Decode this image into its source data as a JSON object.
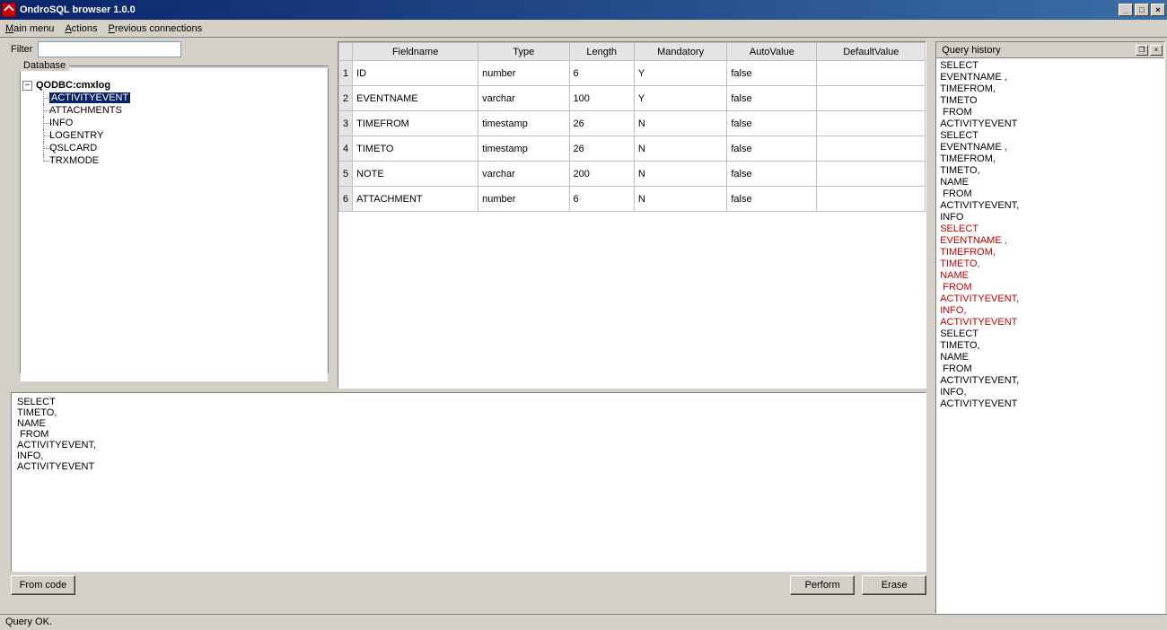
{
  "title": "OndroSQL browser 1.0.0",
  "menu": {
    "main": "Main menu",
    "actions": "Actions",
    "prev": "Previous connections"
  },
  "filter": {
    "label": "Filter",
    "value": ""
  },
  "dbgroup": {
    "title": "Database"
  },
  "tree": {
    "root": "QODBC:cmxlog",
    "items": [
      "ACTIVITYEVENT",
      "ATTACHMENTS",
      "INFO",
      "LOGENTRY",
      "QSLCARD",
      "TRXMODE"
    ],
    "selected": 0
  },
  "grid": {
    "headers": [
      "Fieldname",
      "Type",
      "Length",
      "Mandatory",
      "AutoValue",
      "DefaultValue"
    ],
    "rows": [
      {
        "n": "1",
        "f": "ID",
        "t": "number",
        "l": "6",
        "m": "Y",
        "a": "false",
        "d": ""
      },
      {
        "n": "2",
        "f": "EVENTNAME",
        "t": "varchar",
        "l": "100",
        "m": "Y",
        "a": "false",
        "d": ""
      },
      {
        "n": "3",
        "f": "TIMEFROM",
        "t": "timestamp",
        "l": "26",
        "m": "N",
        "a": "false",
        "d": ""
      },
      {
        "n": "4",
        "f": "TIMETO",
        "t": "timestamp",
        "l": "26",
        "m": "N",
        "a": "false",
        "d": ""
      },
      {
        "n": "5",
        "f": "NOTE",
        "t": "varchar",
        "l": "200",
        "m": "N",
        "a": "false",
        "d": ""
      },
      {
        "n": "6",
        "f": "ATTACHMENT",
        "t": "number",
        "l": "6",
        "m": "N",
        "a": "false",
        "d": ""
      }
    ]
  },
  "sql": "SELECT\nTIMETO,\nNAME\n FROM\nACTIVITYEVENT,\nINFO,\nACTIVITYEVENT",
  "buttons": {
    "fromcode": "From code",
    "perform": "Perform",
    "erase": "Erase"
  },
  "status": "Query OK.",
  "history": {
    "title": "Query history",
    "entries": [
      {
        "text": "SELECT\nEVENTNAME ,\nTIMEFROM,\nTIMETO\n FROM\nACTIVITYEVENT",
        "err": false
      },
      {
        "text": "SELECT\nEVENTNAME ,\nTIMEFROM,\nTIMETO,\nNAME\n FROM\nACTIVITYEVENT,\nINFO",
        "err": false
      },
      {
        "text": "SELECT\nEVENTNAME ,\nTIMEFROM,\nTIMETO,\nNAME\n FROM\nACTIVITYEVENT,\nINFO,\nACTIVITYEVENT",
        "err": true
      },
      {
        "text": "SELECT\nTIMETO,\nNAME\n FROM\nACTIVITYEVENT,\nINFO,\nACTIVITYEVENT",
        "err": false
      }
    ]
  }
}
